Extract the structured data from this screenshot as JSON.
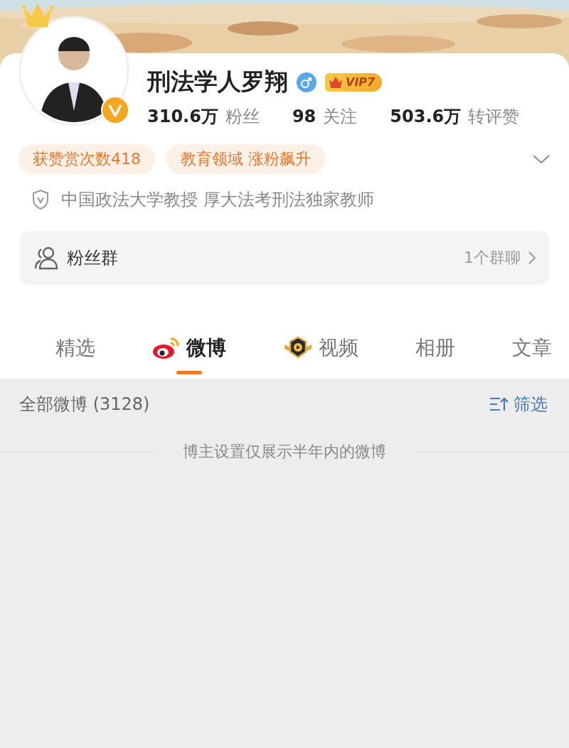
{
  "profile": {
    "name": "刑法学人罗翔",
    "vip_badge": "VIP7",
    "stats": [
      {
        "value": "310.6万",
        "label": "粉丝"
      },
      {
        "value": "98",
        "label": "关注"
      },
      {
        "value": "503.6万",
        "label": "转评赞"
      }
    ]
  },
  "tags": [
    "获赞赏次数418",
    "教育领域 涨粉飙升"
  ],
  "verification": "中国政法大学教授 厚大法考刑法独家教师",
  "fan_group": {
    "label": "粉丝群",
    "count": "1个群聊"
  },
  "tabs": [
    {
      "label": "精选",
      "kind": "plain",
      "selected": false
    },
    {
      "label": "微博",
      "kind": "weibo",
      "selected": true
    },
    {
      "label": "视频",
      "kind": "video",
      "selected": false
    },
    {
      "label": "相册",
      "kind": "plain",
      "selected": false
    },
    {
      "label": "文章",
      "kind": "plain",
      "selected": false
    }
  ],
  "feed": {
    "title": "全部微博 (3128)",
    "filter": "筛选",
    "notice": "博主设置仅展示半年内的微博"
  }
}
